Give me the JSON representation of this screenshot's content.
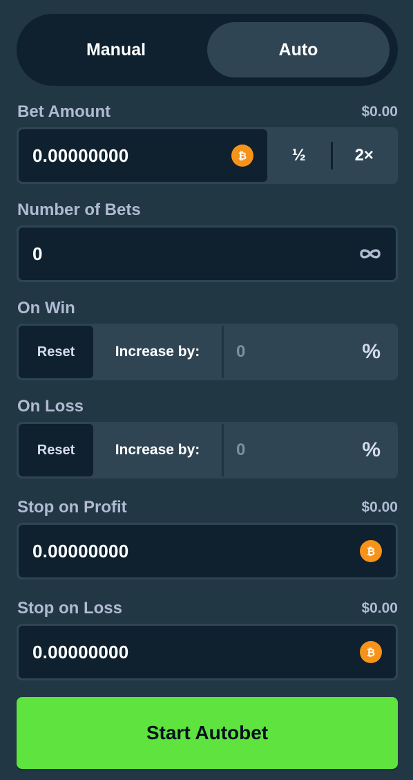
{
  "tabs": {
    "manual": "Manual",
    "auto": "Auto",
    "active": "auto"
  },
  "bet_amount": {
    "label": "Bet Amount",
    "usd": "$0.00",
    "value": "0.00000000",
    "half": "½",
    "double": "2×",
    "currency_icon": "bitcoin-icon"
  },
  "number_of_bets": {
    "label": "Number of Bets",
    "value": "0",
    "icon": "infinity-icon"
  },
  "on_win": {
    "label": "On Win",
    "reset": "Reset",
    "increase_label": "Increase by:",
    "value": "0",
    "unit": "%"
  },
  "on_loss": {
    "label": "On Loss",
    "reset": "Reset",
    "increase_label": "Increase by:",
    "value": "0",
    "unit": "%"
  },
  "stop_on_profit": {
    "label": "Stop on Profit",
    "usd": "$0.00",
    "value": "0.00000000"
  },
  "stop_on_loss": {
    "label": "Stop on Loss",
    "usd": "$0.00",
    "value": "0.00000000"
  },
  "start_button": "Start Autobet",
  "colors": {
    "background": "#213743",
    "input_bg": "#0f212e",
    "field_bg": "#2f4553",
    "label": "#b1bad3",
    "accent_green": "#5ee33f",
    "bitcoin": "#f7931a"
  }
}
